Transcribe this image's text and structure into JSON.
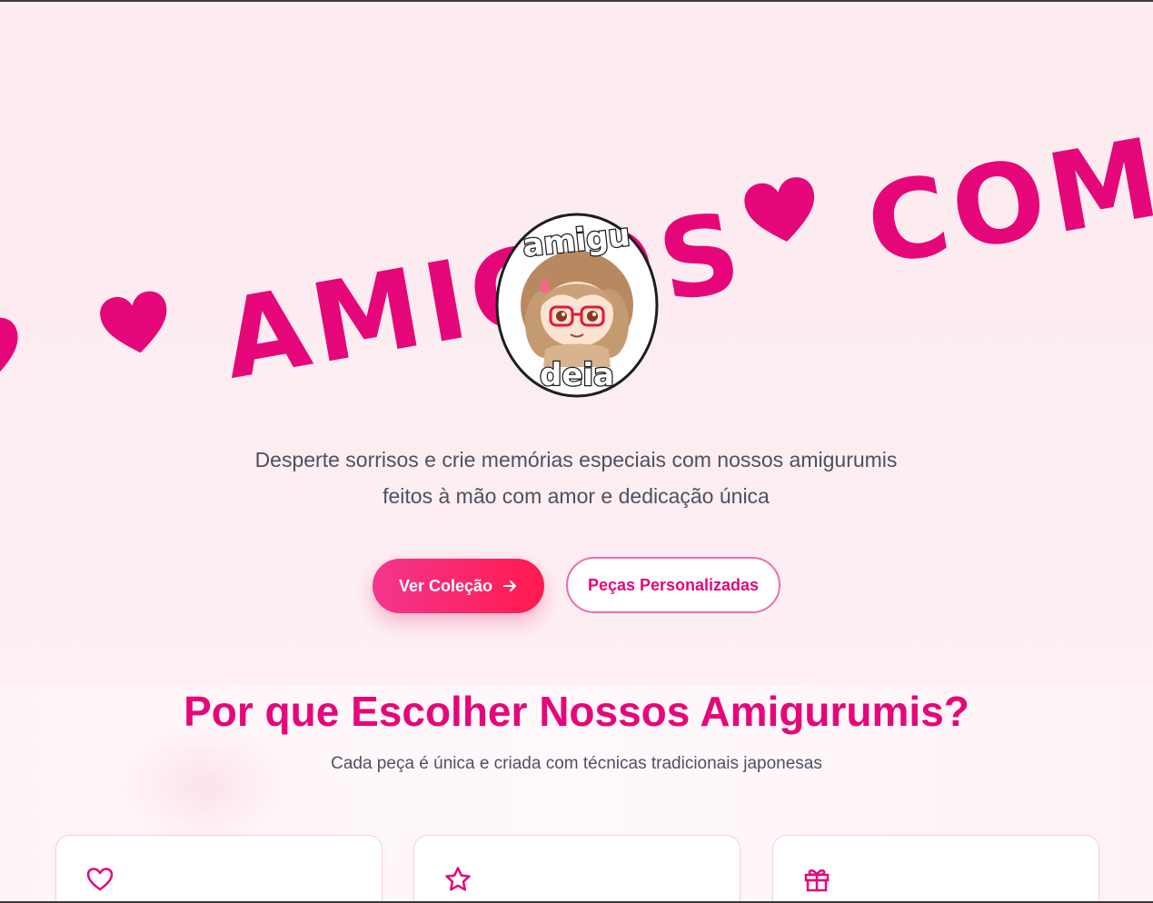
{
  "hero": {
    "marquee_words": [
      "AMIGOS",
      "COM"
    ],
    "logo": {
      "top_text": "amigu",
      "bottom_text": "deia"
    },
    "subtitle_line1": "Desperte sorrisos e crie memórias especiais com nossos amigurumis",
    "subtitle_line2": "feitos à mão com amor e dedicação única",
    "primary_button": "Ver Coleção",
    "secondary_button": "Peças Personalizadas"
  },
  "features": {
    "title": "Por que Escolher Nossos Amigurumis?",
    "subtitle": "Cada peça é única e criada com técnicas tradicionais japonesas",
    "cards": [
      {
        "icon": "heart-icon"
      },
      {
        "icon": "star-icon"
      },
      {
        "icon": "gift-icon"
      }
    ]
  },
  "colors": {
    "accent": "#e5077a",
    "button_gradient_start": "#f4368f",
    "button_gradient_end": "#ff1a4c",
    "text_muted": "#4e5160",
    "background": "#fcebf0"
  }
}
